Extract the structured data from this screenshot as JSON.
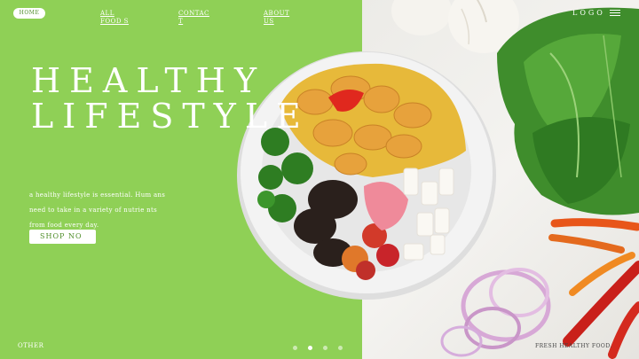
{
  "nav": {
    "home": "HOME",
    "links": [
      "ALL FOOD S",
      "CONTAC T",
      "ABOUT US"
    ]
  },
  "logo": "LOGO",
  "hero": {
    "title_line1": "HEALTHY",
    "title_line2": "LIFESTYLE",
    "description_line1": "a healthy lifestyle is essential. Hum ans",
    "description_line2": "need to take in a variety of nutrie nts",
    "description_line3": "from food every day.",
    "shop_button": "SHOP NO"
  },
  "footer": {
    "left": "OTHER",
    "right": "FRESH HEALTHY FOOD.",
    "slides": 4,
    "active_slide": 2
  },
  "colors": {
    "green_panel": "#8fd056",
    "white": "#ffffff",
    "accent_text": "#4f8e2a"
  }
}
